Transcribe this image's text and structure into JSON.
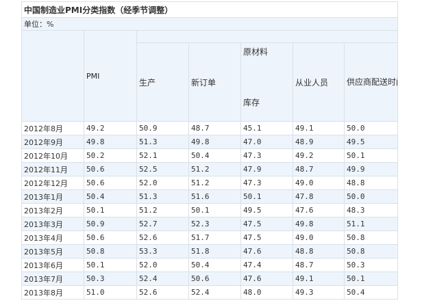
{
  "title": "中国制造业PMI分类指数（经季节调整）",
  "unit": "单位：%",
  "headers": {
    "pmi": "PMI",
    "production": "生产",
    "new_orders": "新订单",
    "raw_material_top": "原材料",
    "raw_material_bottom": "库存",
    "employment": "从业人员",
    "supplier": "供应商配送时间"
  },
  "rows": [
    {
      "month": "2012年8月",
      "pmi": "49.2",
      "production": "50.9",
      "new_orders": "48.7",
      "raw_material": "45.1",
      "employment": "49.1",
      "supplier": "50.0"
    },
    {
      "month": "2012年9月",
      "pmi": "49.8",
      "production": "51.3",
      "new_orders": "49.8",
      "raw_material": "47.0",
      "employment": "48.9",
      "supplier": "49.5"
    },
    {
      "month": "2012年10月",
      "pmi": "50.2",
      "production": "52.1",
      "new_orders": "50.4",
      "raw_material": "47.3",
      "employment": "49.2",
      "supplier": "50.1"
    },
    {
      "month": "2012年11月",
      "pmi": "50.6",
      "production": "52.5",
      "new_orders": "51.2",
      "raw_material": "47.9",
      "employment": "48.7",
      "supplier": "49.9"
    },
    {
      "month": "2012年12月",
      "pmi": "50.6",
      "production": "52.0",
      "new_orders": "51.2",
      "raw_material": "47.3",
      "employment": "49.0",
      "supplier": "48.8"
    },
    {
      "month": "2013年1月",
      "pmi": "50.4",
      "production": "51.3",
      "new_orders": "51.6",
      "raw_material": "50.1",
      "employment": "47.8",
      "supplier": "50.0"
    },
    {
      "month": "2013年2月",
      "pmi": "50.1",
      "production": "51.2",
      "new_orders": "50.1",
      "raw_material": "49.5",
      "employment": "47.6",
      "supplier": "48.3"
    },
    {
      "month": "2013年3月",
      "pmi": "50.9",
      "production": "52.7",
      "new_orders": "52.3",
      "raw_material": "47.5",
      "employment": "49.8",
      "supplier": "51.1"
    },
    {
      "month": "2013年4月",
      "pmi": "50.6",
      "production": "52.6",
      "new_orders": "51.7",
      "raw_material": "47.5",
      "employment": "49.0",
      "supplier": "50.8"
    },
    {
      "month": "2013年5月",
      "pmi": "50.8",
      "production": "53.3",
      "new_orders": "51.8",
      "raw_material": "47.6",
      "employment": "48.8",
      "supplier": "50.8"
    },
    {
      "month": "2013年6月",
      "pmi": "50.1",
      "production": "52.0",
      "new_orders": "50.4",
      "raw_material": "47.4",
      "employment": "48.7",
      "supplier": "50.3"
    },
    {
      "month": "2013年7月",
      "pmi": "50.3",
      "production": "52.4",
      "new_orders": "50.6",
      "raw_material": "47.6",
      "employment": "49.1",
      "supplier": "50.1"
    },
    {
      "month": "2013年8月",
      "pmi": "51.0",
      "production": "52.6",
      "new_orders": "52.4",
      "raw_material": "48.0",
      "employment": "49.3",
      "supplier": "50.4"
    }
  ]
}
